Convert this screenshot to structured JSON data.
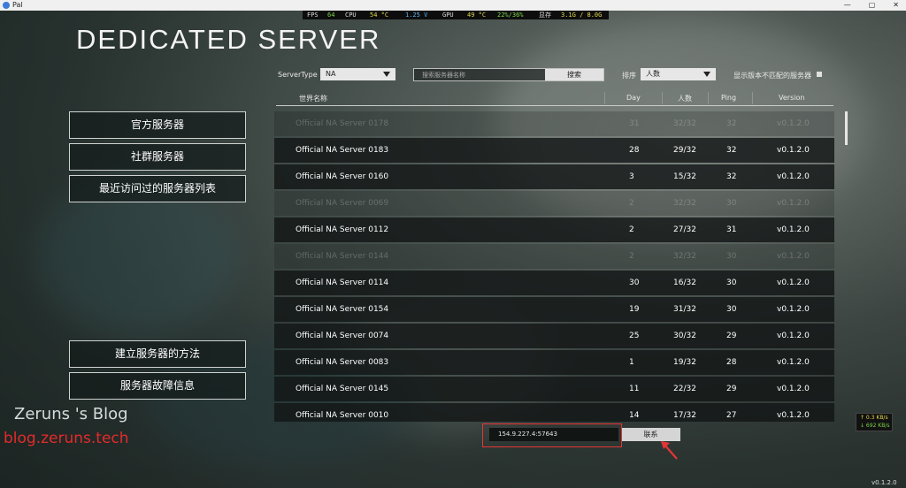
{
  "window": {
    "app_title": "Pal"
  },
  "hud": {
    "fps_label": "FPS",
    "fps": "64",
    "cpu_label": "CPU",
    "cpu_temp": "54 °C",
    "cpu_volt": "1.25 V",
    "gpu_label": "GPU",
    "gpu_temp": "49 °C",
    "gpu_usage": "22%/36%",
    "mem_label": "显存",
    "mem": "3.1G / 8.0G",
    "colors": {
      "value_green": "#7fd44a",
      "value_yellow": "#e3d94a",
      "value_blue": "#5fb3f0"
    }
  },
  "title": "DEDICATED SERVER",
  "filters": {
    "server_type_label": "ServerType",
    "server_type_value": "NA",
    "search_placeholder": "搜索服务器名称",
    "search_button": "搜索",
    "sort_label": "排序",
    "sort_value": "人数",
    "mismatch_label": "显示版本不匹配的服务器"
  },
  "left_menu": {
    "official": "官方服务器",
    "community": "社群服务器",
    "recent": "最近访问过的服务器列表",
    "howto": "建立服务器的方法",
    "trouble": "服务器故障信息"
  },
  "table": {
    "headers": {
      "name": "世界名称",
      "day": "Day",
      "players": "人数",
      "ping": "Ping",
      "version": "Version"
    },
    "rows": [
      {
        "name": "Official NA Server 0178",
        "day": "31",
        "players": "32/32",
        "ping": "32",
        "version": "v0.1.2.0",
        "faded": true
      },
      {
        "name": "Official NA Server 0183",
        "day": "28",
        "players": "29/32",
        "ping": "32",
        "version": "v0.1.2.0",
        "faded": false
      },
      {
        "name": "Official NA Server 0160",
        "day": "3",
        "players": "15/32",
        "ping": "32",
        "version": "v0.1.2.0",
        "faded": false
      },
      {
        "name": "Official NA Server 0069",
        "day": "2",
        "players": "32/32",
        "ping": "30",
        "version": "v0.1.2.0",
        "faded": true
      },
      {
        "name": "Official NA Server 0112",
        "day": "2",
        "players": "27/32",
        "ping": "31",
        "version": "v0.1.2.0",
        "faded": false
      },
      {
        "name": "Official NA Server 0144",
        "day": "2",
        "players": "32/32",
        "ping": "30",
        "version": "v0.1.2.0",
        "faded": true
      },
      {
        "name": "Official NA Server 0114",
        "day": "30",
        "players": "16/32",
        "ping": "30",
        "version": "v0.1.2.0",
        "faded": false
      },
      {
        "name": "Official NA Server 0154",
        "day": "19",
        "players": "31/32",
        "ping": "30",
        "version": "v0.1.2.0",
        "faded": false
      },
      {
        "name": "Official NA Server 0074",
        "day": "25",
        "players": "30/32",
        "ping": "29",
        "version": "v0.1.2.0",
        "faded": false
      },
      {
        "name": "Official NA Server 0083",
        "day": "1",
        "players": "19/32",
        "ping": "28",
        "version": "v0.1.2.0",
        "faded": false
      },
      {
        "name": "Official NA Server 0145",
        "day": "11",
        "players": "22/32",
        "ping": "29",
        "version": "v0.1.2.0",
        "faded": false
      },
      {
        "name": "Official NA Server 0010",
        "day": "14",
        "players": "17/32",
        "ping": "27",
        "version": "v0.1.2.0",
        "faded": false
      }
    ]
  },
  "connect": {
    "ip_value": "154.9.227.4:57643",
    "button": "联系",
    "highlight_color": "#e53535"
  },
  "watermark": {
    "line1": "Zeruns 's Blog",
    "line2": "blog.zeruns.tech"
  },
  "net_speed": {
    "up": "↑ 0.3 KB/s",
    "down": "↓ 692 KB/s"
  },
  "version": "v0.1.2.0"
}
